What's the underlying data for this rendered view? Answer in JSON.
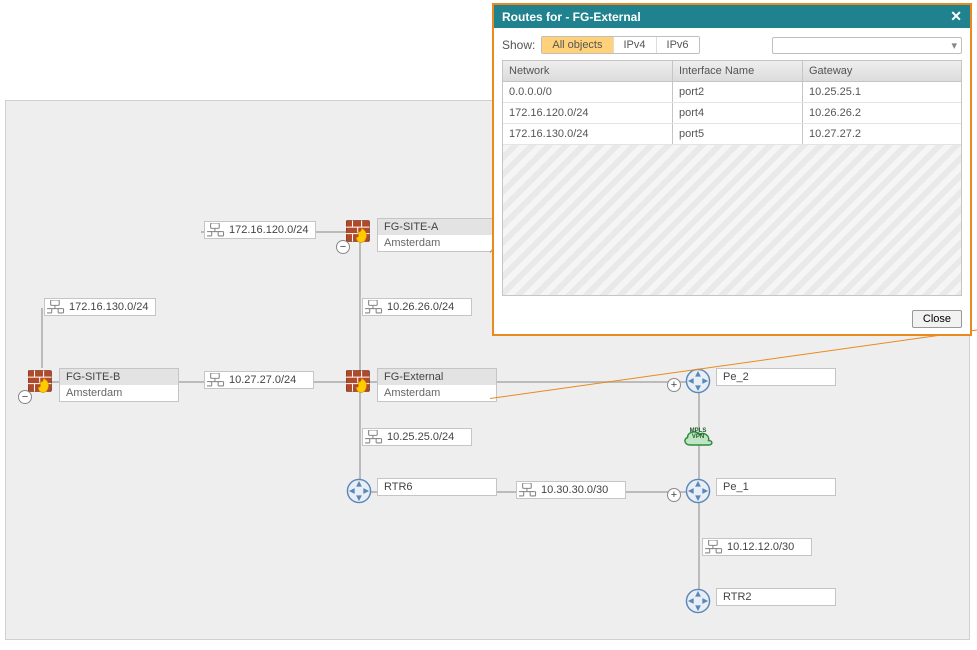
{
  "popup": {
    "title": "Routes for - FG-External",
    "show_label": "Show:",
    "filters": [
      "All objects",
      "IPv4",
      "IPv6"
    ],
    "filter_active": "All objects",
    "search_placeholder": "",
    "columns": [
      "Network",
      "Interface Name",
      "Gateway"
    ],
    "rows": [
      {
        "network": "0.0.0.0/0",
        "iface": "port2",
        "gateway": "10.25.25.1"
      },
      {
        "network": "172.16.120.0/24",
        "iface": "port4",
        "gateway": "10.26.26.2"
      },
      {
        "network": "172.16.130.0/24",
        "iface": "port5",
        "gateway": "10.27.27.2"
      }
    ],
    "close_label": "Close"
  },
  "nodes": {
    "fg_site_b": {
      "name": "FG-SITE-B",
      "location": "Amsterdam",
      "badge": "−"
    },
    "fg_site_a": {
      "name": "FG-SITE-A",
      "location": "Amsterdam",
      "badge": "−"
    },
    "fg_external": {
      "name": "FG-External",
      "location": "Amsterdam"
    },
    "pe_2": {
      "name": "Pe_2",
      "badge": "+"
    },
    "pe_1": {
      "name": "Pe_1",
      "badge": "+"
    },
    "rtr6": {
      "name": "RTR6"
    },
    "rtr2": {
      "name": "RTR2"
    },
    "mpls": {
      "label1": "MPLS",
      "label2": "VPN"
    }
  },
  "nets": {
    "n130": "172.16.130.0/24",
    "n120": "172.16.120.0/24",
    "n26": "10.26.26.0/24",
    "n27": "10.27.27.0/24",
    "n25": "10.25.25.0/24",
    "n30": "10.30.30.0/30",
    "n12": "10.12.12.0/30"
  }
}
